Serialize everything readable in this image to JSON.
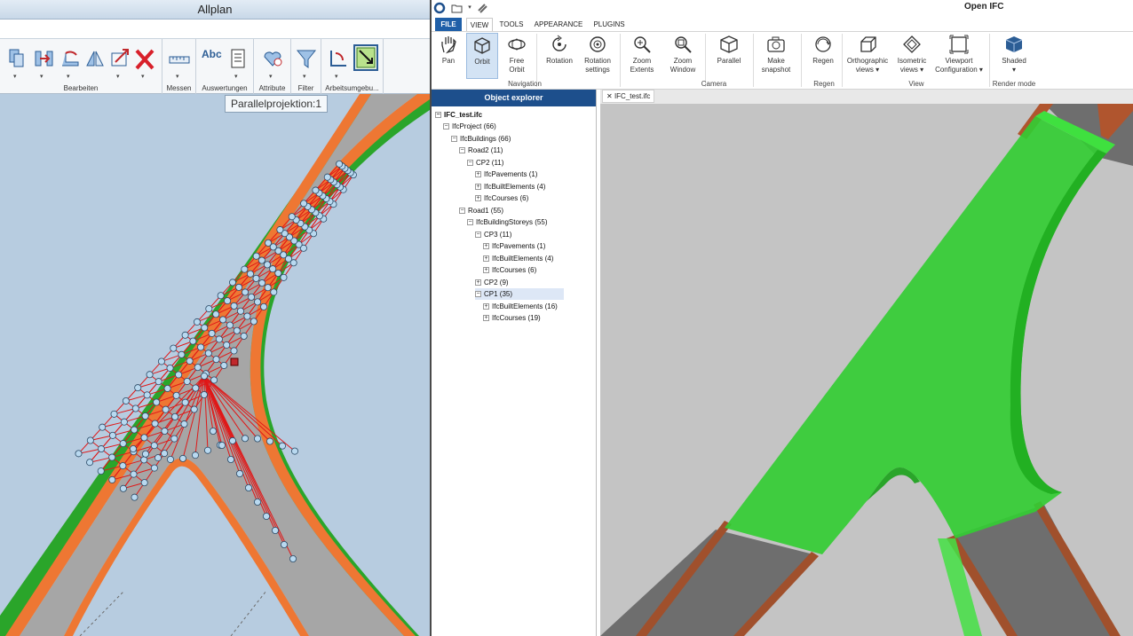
{
  "allplan": {
    "title": "Allplan",
    "groups": [
      {
        "label": "Bearbeiten"
      },
      {
        "label": "Messen"
      },
      {
        "label": "Auswertungen"
      },
      {
        "label": "Attribute"
      },
      {
        "label": "Filter"
      },
      {
        "label": "Arbeitsumgebu..."
      }
    ],
    "abc_label": "Abc",
    "tooltip": "Parallelprojektion:1"
  },
  "openifc": {
    "app_title": "Open IFC",
    "tabs": [
      "FILE",
      "VIEW",
      "TOOLS",
      "APPEARANCE",
      "PLUGINS"
    ],
    "ribbon": {
      "pan": "Pan",
      "orbit": "Orbit",
      "free_orbit_1": "Free",
      "free_orbit_2": "Orbit",
      "rotation": "Rotation",
      "rotation_settings_1": "Rotation",
      "rotation_settings_2": "settings",
      "zoom_extents_1": "Zoom",
      "zoom_extents_2": "Extents",
      "zoom_window_1": "Zoom",
      "zoom_window_2": "Window",
      "parallel": "Parallel",
      "make_snapshot_1": "Make",
      "make_snapshot_2": "snapshot",
      "regen": "Regen",
      "ortho_1": "Orthographic",
      "ortho_2": "views",
      "iso_1": "Isometric",
      "iso_2": "views",
      "viewport_1": "Viewport",
      "viewport_2": "Configuration",
      "shaded": "Shaded",
      "group_navigation": "Navigation",
      "group_camera": "Camera",
      "group_regen": "Regen",
      "group_view": "View",
      "group_render": "Render mode"
    },
    "explorer": {
      "header": "Object explorer",
      "nodes": [
        "IFC_test.ifc",
        "IfcProject (66)",
        "IfcBuildings (66)",
        "Road2 (11)",
        "CP2 (11)",
        "IfcPavements (1)",
        "IfcBuiltElements (4)",
        "IfcCourses (6)",
        "Road1 (55)",
        "IfcBuildingStoreys (55)",
        "CP3 (11)",
        "IfcPavements (1)",
        "IfcBuiltElements (4)",
        "IfcCourses (6)",
        "CP2 (9)",
        "CP1 (35)",
        "IfcBuiltElements (16)",
        "IfcCourses (19)"
      ]
    },
    "document_tab": "IFC_test.ifc"
  },
  "colors": {
    "road_gray": "#a6a6a6",
    "curb_orange": "#ee7733",
    "verge_green": "#2aa52a",
    "mesh_red": "#e01818",
    "node_blue": "#b9d9f0",
    "ifc_green": "#33cc33",
    "ifc_blue_header": "#1d4f8c"
  }
}
